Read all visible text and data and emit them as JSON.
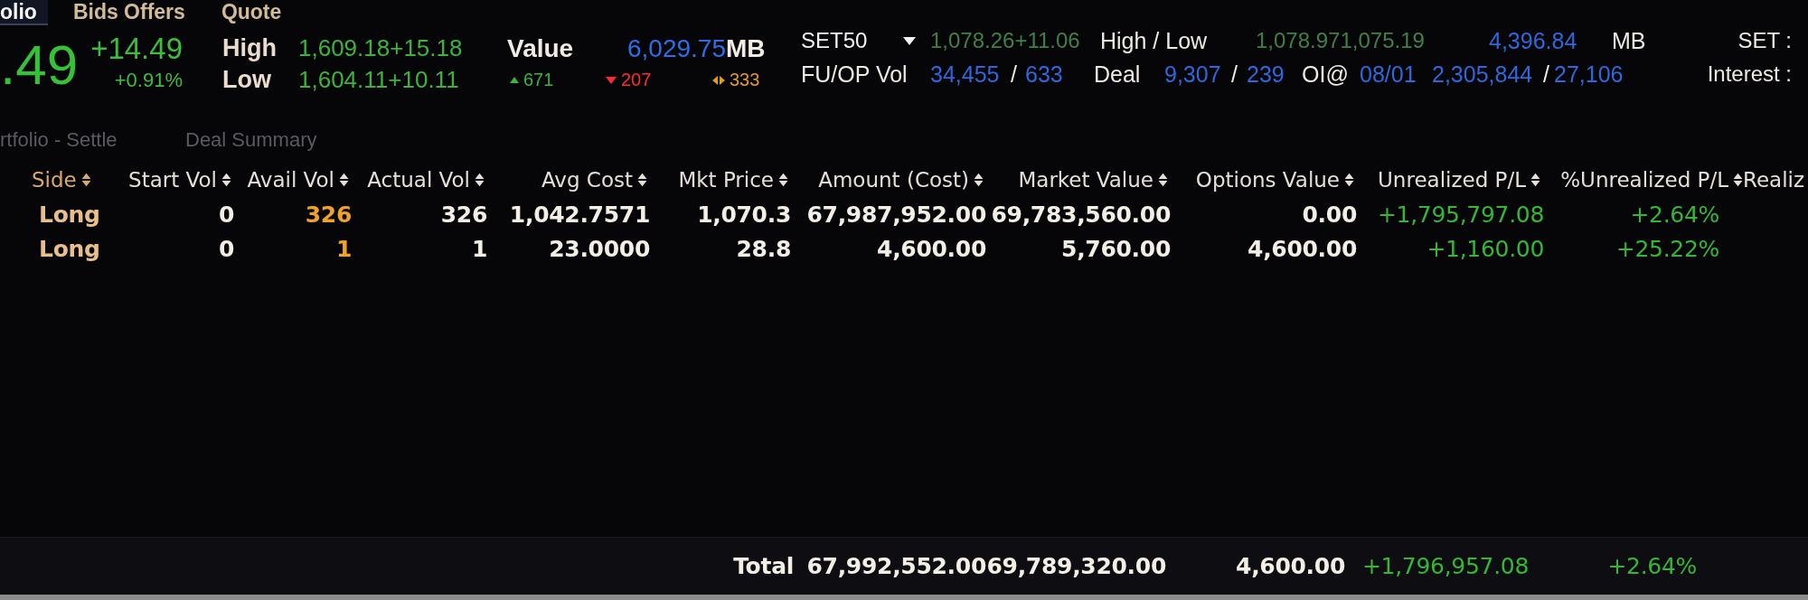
{
  "tabs": [
    {
      "label": "olio",
      "selected": true
    },
    {
      "label": "Bids Offers",
      "selected": false
    },
    {
      "label": "Quote",
      "selected": false
    }
  ],
  "index_quote": {
    "last": ".49",
    "change": "+14.49",
    "change_percent": "+0.91%",
    "high": {
      "label": "High",
      "value": "1,609.18",
      "change": "+15.18"
    },
    "low": {
      "label": "Low",
      "value": "1,604.11",
      "change": "+10.11"
    },
    "value": {
      "label": "Value",
      "amount": "6,029.75",
      "unit": "MB"
    },
    "breadth": [
      {
        "kind": "up",
        "count": "671"
      },
      {
        "kind": "down",
        "count": "207"
      },
      {
        "kind": "unchanged",
        "count": "333"
      }
    ]
  },
  "set50": {
    "name": "SET50",
    "last": "1,078.26",
    "change": "+11.06",
    "high_low": {
      "label": "High / Low",
      "high": "1,078.97",
      "low": "1,075.19"
    },
    "value": {
      "amount": "4,396.84",
      "unit": "MB"
    },
    "fu_op_vol": {
      "label": "FU/OP Vol",
      "futures": "34,455",
      "separator": "/",
      "options": "633"
    },
    "deal": {
      "label": "Deal",
      "futures": "9,307",
      "separator": "/",
      "options": "239"
    },
    "open_interest": {
      "label": "OI@",
      "date": "08/01",
      "futures": "2,305,844",
      "separator": "/",
      "options": "27,106"
    }
  },
  "market_labels": [
    "SET :",
    "Interest :"
  ],
  "sub_tabs": [
    "rtfolio - Settle",
    "Deal Summary"
  ],
  "table": {
    "columns": [
      {
        "label": "Side",
        "kind": "side",
        "sortable": true
      },
      {
        "label": "Start Vol",
        "kind": "number",
        "sortable": true
      },
      {
        "label": "Avail Vol",
        "kind": "highlight",
        "sortable": true
      },
      {
        "label": "Actual Vol",
        "kind": "number",
        "sortable": true
      },
      {
        "label": "Avg Cost",
        "kind": "number",
        "sortable": true
      },
      {
        "label": "Mkt Price",
        "kind": "number",
        "sortable": true
      },
      {
        "label": "Amount (Cost)",
        "kind": "number",
        "sortable": true
      },
      {
        "label": "Market Value",
        "kind": "number",
        "sortable": true
      },
      {
        "label": "Options Value",
        "kind": "number",
        "sortable": true
      },
      {
        "label": "Unrealized P/L",
        "kind": "change",
        "sortable": true
      },
      {
        "label": "%Unrealized P/L",
        "kind": "change",
        "sortable": true
      },
      {
        "label": "Realiz",
        "kind": "number",
        "sortable": false
      }
    ],
    "rows": [
      [
        "Long",
        "0",
        "326",
        "326",
        "1,042.7571",
        "1,070.3",
        "67,987,952.00",
        "69,783,560.00",
        "0.00",
        "+1,795,797.08",
        "+2.64%"
      ],
      [
        "Long",
        "0",
        "1",
        "1",
        "23.0000",
        "28.8",
        "4,600.00",
        "5,760.00",
        "4,600.00",
        "+1,160.00",
        "+25.22%"
      ]
    ],
    "total": {
      "label": "Total",
      "values": [
        "67,992,552.00",
        "69,789,320.00",
        "4,600.00",
        "+1,796,957.08",
        "+2.64%"
      ]
    }
  }
}
